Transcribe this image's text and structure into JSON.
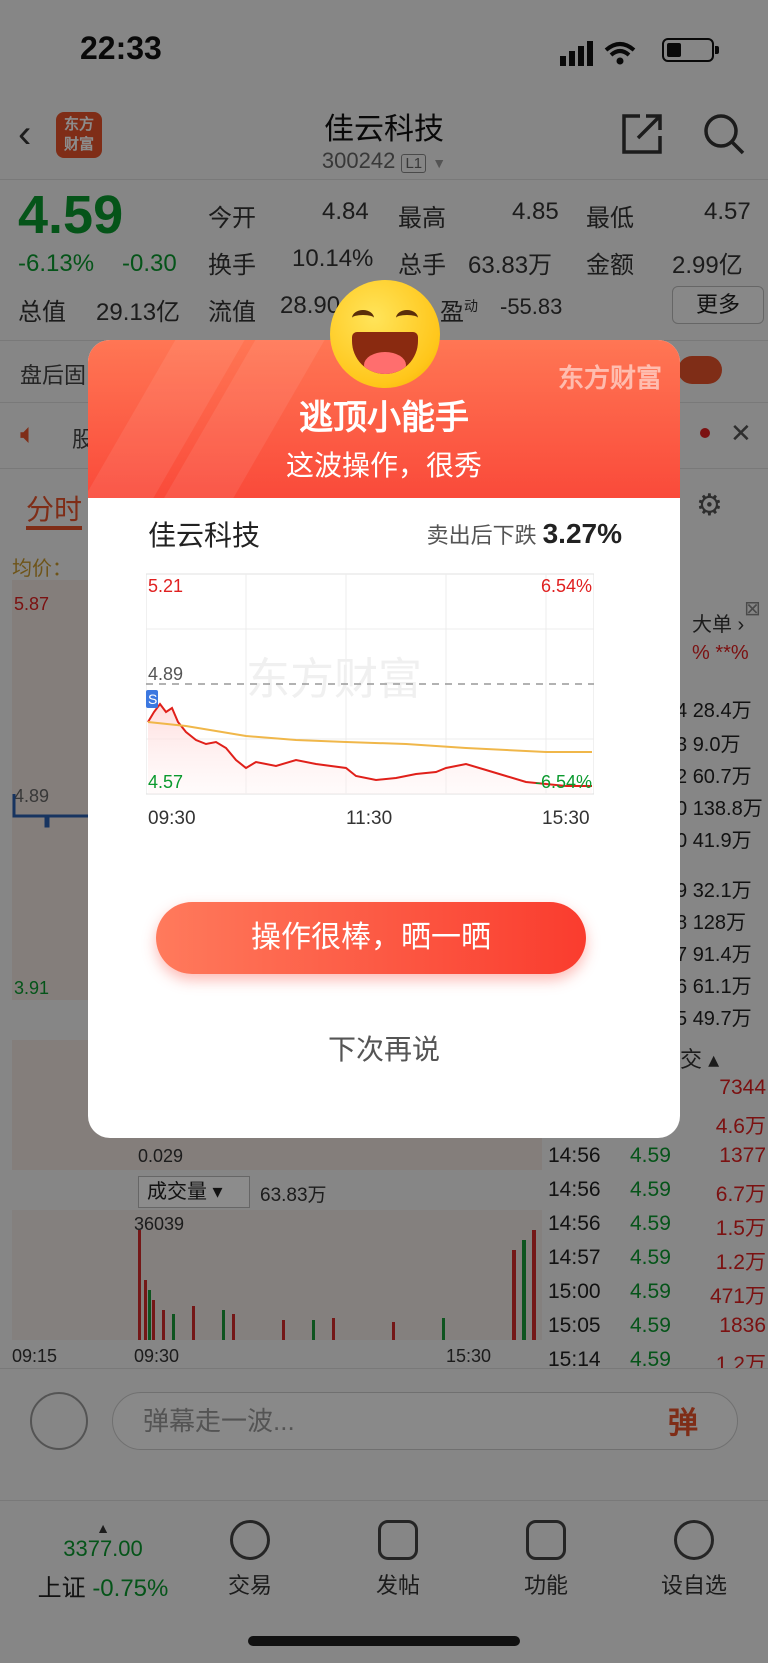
{
  "status": {
    "time": "22:33"
  },
  "header": {
    "back": "‹",
    "logo": "东方\n财富",
    "title": "佳云科技",
    "code": "300242",
    "level": "L1"
  },
  "quote": {
    "price": "4.59",
    "pct": "-6.13%",
    "change": "-0.30",
    "open_label": "今开",
    "open": "4.84",
    "high_label": "最高",
    "high": "4.85",
    "low_label": "最低",
    "low": "4.57",
    "turnover_label": "换手",
    "turnover": "10.14%",
    "vol_label": "总手",
    "vol": "63.83万",
    "amount_label": "金额",
    "amount": "2.99亿",
    "mktcap_label": "总值",
    "mktcap": "29.13亿",
    "float_label": "流值",
    "float": "28.90",
    "pe_label": "盈",
    "pe_sup": "动",
    "pe": "-55.83",
    "more": "更多"
  },
  "background": {
    "after_hours": "盘后固",
    "news": "股",
    "tab_fenshi": "分时",
    "avg_label": "均价：",
    "y_top": "5.87",
    "y_mid": "4.89",
    "y_bot": "3.91",
    "macd_val": "0.029",
    "vol_select": "成交量",
    "vol_total": "63.83万",
    "vol_max": "36039",
    "x_start": "09:15",
    "x_mid": "09:30",
    "x_end": "15:30",
    "bigorder": "大单",
    "right_vals": [
      "28.4万",
      "9.0万",
      "60.7万",
      "138.8万",
      "41.9万",
      "32.1万",
      "128万",
      "91.4万",
      "61.1万",
      "49.7万"
    ],
    "right_prefix": [
      "4",
      "3",
      "2",
      "0",
      "0",
      "9",
      "8",
      "7",
      "6",
      "5"
    ],
    "pct_stars": "%  **%",
    "deal_label": "交",
    "ticks": [
      {
        "t": "",
        "p": "",
        "v": "7344"
      },
      {
        "t": "",
        "p": "",
        "v": "4.6万"
      },
      {
        "t": "14:56",
        "p": "4.59",
        "v": "1377"
      },
      {
        "t": "14:56",
        "p": "4.59",
        "v": "6.7万"
      },
      {
        "t": "14:56",
        "p": "4.59",
        "v": "1.5万"
      },
      {
        "t": "14:57",
        "p": "4.59",
        "v": "1.2万"
      },
      {
        "t": "15:00",
        "p": "4.59",
        "v": "471万"
      },
      {
        "t": "15:05",
        "p": "4.59",
        "v": "1836"
      },
      {
        "t": "15:14",
        "p": "4.59",
        "v": "1.2万"
      }
    ]
  },
  "inputbar": {
    "placeholder": "弹幕走一波...",
    "dan": "弹"
  },
  "tabbar": {
    "index_value": "3377.00",
    "index_label": "上证",
    "index_pct": "-0.75%",
    "tabs": [
      "交易",
      "发帖",
      "功能",
      "设自选"
    ]
  },
  "modal": {
    "brand": "东方财富",
    "title": "逃顶小能手",
    "subtitle": "这波操作，很秀",
    "stock": "佳云科技",
    "drop_label": "卖出后下跌",
    "drop_value": "3.27%",
    "chart": {
      "y_top": "5.21",
      "y_top_pct": "6.54%",
      "ref": "4.89",
      "y_bot": "4.57",
      "y_bot_pct": "-6.54%",
      "x_labels": [
        "09:30",
        "11:30",
        "15:30"
      ],
      "watermark": "东方财富",
      "marker": "S"
    },
    "cta": "操作很棒，晒一晒",
    "later": "下次再说"
  },
  "colors": {
    "up": "#e02020",
    "down": "#0a9a2e",
    "accent": "#fa4a3a"
  }
}
